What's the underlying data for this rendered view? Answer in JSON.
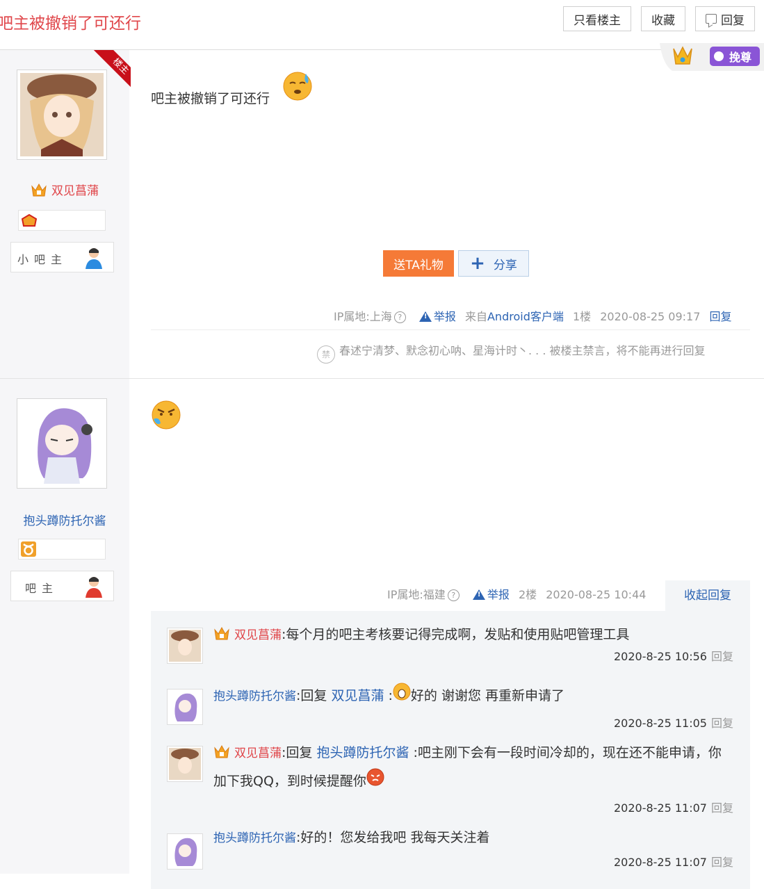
{
  "header": {
    "title": "吧主被撤销了可还行",
    "btn_only_op": "只看楼主",
    "btn_favorite": "收藏",
    "btn_reply": "回复",
    "vip_badge": "挽尊"
  },
  "posts": [
    {
      "ribbon": "楼主",
      "username": "双见菖蒲",
      "role": "小吧主",
      "content": "吧主被撤销了可还行",
      "gift_label": "送TA礼物",
      "share_label": "分享",
      "ip": "IP属地:上海",
      "report": "举报",
      "source": "来自Android客户端",
      "floor": "1楼",
      "time": "2020-08-25 09:17",
      "reply_link": "回复",
      "ban_icon": "禁",
      "ban_text": "春述宁清梦、默念初心呐、星海计时丶. . . 被楼主禁言，将不能再进行回复"
    },
    {
      "username": "抱头蹲防托尔酱",
      "role": "吧主",
      "ip": "IP属地:福建",
      "report": "举报",
      "floor": "2楼",
      "time": "2020-08-25 10:44",
      "collapse": "收起回复",
      "replies": [
        {
          "name": "双见菖蒲",
          "text": ":每个月的吧主考核要记得完成啊，发贴和使用贴吧管理工具",
          "time": "2020-8-25 10:56",
          "reply": "回复"
        },
        {
          "name": "抱头蹲防托尔酱",
          "prefix": ":回复",
          "target": "双见菖蒲",
          "text": "好的 谢谢您 再重新申请了",
          "time": "2020-8-25 11:05",
          "reply": "回复"
        },
        {
          "name": "双见菖蒲",
          "prefix": ":回复",
          "target": "抱头蹲防托尔酱",
          "text": ":吧主刚下会有一段时间冷却的，现在还不能申请，你加下我QQ，到时候提醒你",
          "time": "2020-8-25 11:07",
          "reply": "回复"
        },
        {
          "name": "抱头蹲防托尔酱",
          "text": ":好的！您发给我吧 我每天关注着",
          "time": "2020-8-25 11:07",
          "reply": "回复"
        }
      ]
    }
  ],
  "colors": {
    "accent_red": "#e0474b",
    "link_blue": "#2d64b3",
    "gift_orange": "#f57a37"
  }
}
